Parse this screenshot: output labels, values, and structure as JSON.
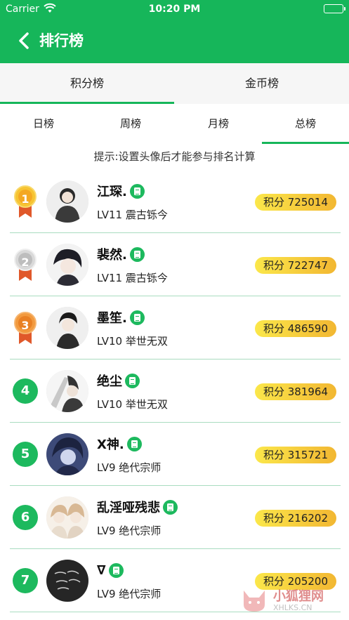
{
  "status": {
    "carrier": "Carrier",
    "time": "10:20 PM"
  },
  "nav": {
    "title": "排行榜"
  },
  "main_tabs": [
    {
      "label": "积分榜",
      "active": true
    },
    {
      "label": "金币榜",
      "active": false
    }
  ],
  "sub_tabs": [
    {
      "label": "日榜",
      "active": false
    },
    {
      "label": "周榜",
      "active": false
    },
    {
      "label": "月榜",
      "active": false
    },
    {
      "label": "总榜",
      "active": true
    }
  ],
  "hint": "提示:设置头像后才能参与排名计算",
  "rows": [
    {
      "rank": "1",
      "medal": "gold",
      "name": "江琛.",
      "level": "LV11 震古铄今",
      "score": "积分 725014"
    },
    {
      "rank": "2",
      "medal": "silver",
      "name": "裴然.",
      "level": "LV11 震古铄今",
      "score": "积分 722747"
    },
    {
      "rank": "3",
      "medal": "bronze",
      "name": "墨笙.",
      "level": "LV10 举世无双",
      "score": "积分 486590"
    },
    {
      "rank": "4",
      "medal": "",
      "name": "绝尘",
      "level": "LV10 举世无双",
      "score": "积分 381964"
    },
    {
      "rank": "5",
      "medal": "",
      "name": "X神.",
      "level": "LV9 绝代宗师",
      "score": "积分 315721"
    },
    {
      "rank": "6",
      "medal": "",
      "name": "乱淫哑残悲",
      "level": "LV9 绝代宗师",
      "score": "积分 216202"
    },
    {
      "rank": "7",
      "medal": "",
      "name": "∇",
      "level": "LV9 绝代宗师",
      "score": "积分 205200"
    }
  ],
  "watermark": {
    "line1": "小狐狸网",
    "line2": "XHLKS.CN"
  },
  "colors": {
    "primary": "#16b65a",
    "badge": "#1db95e",
    "divider": "#a9dcc0",
    "score_start": "#fbe74a",
    "score_end": "#f2b732"
  },
  "icons": {
    "back": "chevron-left-icon",
    "wifi": "wifi-icon",
    "battery": "battery-icon",
    "doc": "document-icon"
  }
}
